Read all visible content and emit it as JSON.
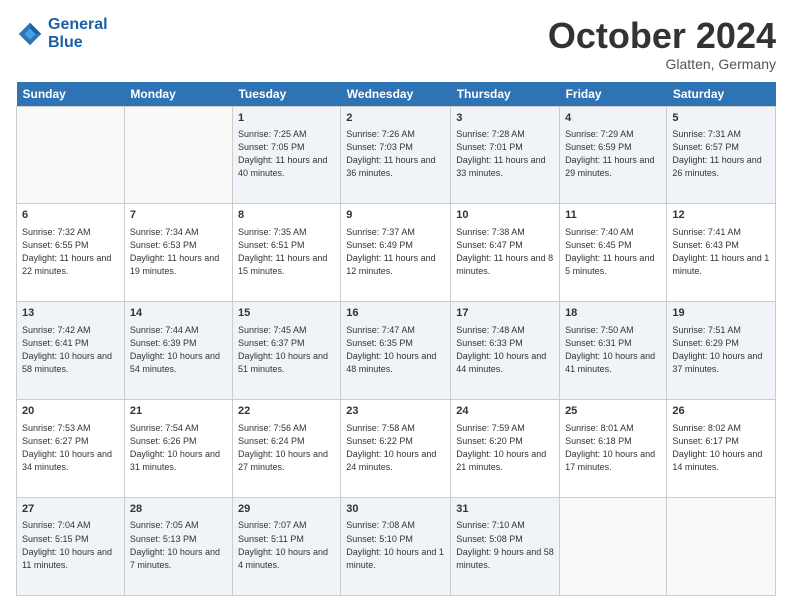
{
  "header": {
    "logo_line1": "General",
    "logo_line2": "Blue",
    "month_title": "October 2024",
    "location": "Glatten, Germany"
  },
  "days_of_week": [
    "Sunday",
    "Monday",
    "Tuesday",
    "Wednesday",
    "Thursday",
    "Friday",
    "Saturday"
  ],
  "weeks": [
    [
      {
        "day": "",
        "sunrise": "",
        "sunset": "",
        "daylight": ""
      },
      {
        "day": "",
        "sunrise": "",
        "sunset": "",
        "daylight": ""
      },
      {
        "day": "1",
        "sunrise": "Sunrise: 7:25 AM",
        "sunset": "Sunset: 7:05 PM",
        "daylight": "Daylight: 11 hours and 40 minutes."
      },
      {
        "day": "2",
        "sunrise": "Sunrise: 7:26 AM",
        "sunset": "Sunset: 7:03 PM",
        "daylight": "Daylight: 11 hours and 36 minutes."
      },
      {
        "day": "3",
        "sunrise": "Sunrise: 7:28 AM",
        "sunset": "Sunset: 7:01 PM",
        "daylight": "Daylight: 11 hours and 33 minutes."
      },
      {
        "day": "4",
        "sunrise": "Sunrise: 7:29 AM",
        "sunset": "Sunset: 6:59 PM",
        "daylight": "Daylight: 11 hours and 29 minutes."
      },
      {
        "day": "5",
        "sunrise": "Sunrise: 7:31 AM",
        "sunset": "Sunset: 6:57 PM",
        "daylight": "Daylight: 11 hours and 26 minutes."
      }
    ],
    [
      {
        "day": "6",
        "sunrise": "Sunrise: 7:32 AM",
        "sunset": "Sunset: 6:55 PM",
        "daylight": "Daylight: 11 hours and 22 minutes."
      },
      {
        "day": "7",
        "sunrise": "Sunrise: 7:34 AM",
        "sunset": "Sunset: 6:53 PM",
        "daylight": "Daylight: 11 hours and 19 minutes."
      },
      {
        "day": "8",
        "sunrise": "Sunrise: 7:35 AM",
        "sunset": "Sunset: 6:51 PM",
        "daylight": "Daylight: 11 hours and 15 minutes."
      },
      {
        "day": "9",
        "sunrise": "Sunrise: 7:37 AM",
        "sunset": "Sunset: 6:49 PM",
        "daylight": "Daylight: 11 hours and 12 minutes."
      },
      {
        "day": "10",
        "sunrise": "Sunrise: 7:38 AM",
        "sunset": "Sunset: 6:47 PM",
        "daylight": "Daylight: 11 hours and 8 minutes."
      },
      {
        "day": "11",
        "sunrise": "Sunrise: 7:40 AM",
        "sunset": "Sunset: 6:45 PM",
        "daylight": "Daylight: 11 hours and 5 minutes."
      },
      {
        "day": "12",
        "sunrise": "Sunrise: 7:41 AM",
        "sunset": "Sunset: 6:43 PM",
        "daylight": "Daylight: 11 hours and 1 minute."
      }
    ],
    [
      {
        "day": "13",
        "sunrise": "Sunrise: 7:42 AM",
        "sunset": "Sunset: 6:41 PM",
        "daylight": "Daylight: 10 hours and 58 minutes."
      },
      {
        "day": "14",
        "sunrise": "Sunrise: 7:44 AM",
        "sunset": "Sunset: 6:39 PM",
        "daylight": "Daylight: 10 hours and 54 minutes."
      },
      {
        "day": "15",
        "sunrise": "Sunrise: 7:45 AM",
        "sunset": "Sunset: 6:37 PM",
        "daylight": "Daylight: 10 hours and 51 minutes."
      },
      {
        "day": "16",
        "sunrise": "Sunrise: 7:47 AM",
        "sunset": "Sunset: 6:35 PM",
        "daylight": "Daylight: 10 hours and 48 minutes."
      },
      {
        "day": "17",
        "sunrise": "Sunrise: 7:48 AM",
        "sunset": "Sunset: 6:33 PM",
        "daylight": "Daylight: 10 hours and 44 minutes."
      },
      {
        "day": "18",
        "sunrise": "Sunrise: 7:50 AM",
        "sunset": "Sunset: 6:31 PM",
        "daylight": "Daylight: 10 hours and 41 minutes."
      },
      {
        "day": "19",
        "sunrise": "Sunrise: 7:51 AM",
        "sunset": "Sunset: 6:29 PM",
        "daylight": "Daylight: 10 hours and 37 minutes."
      }
    ],
    [
      {
        "day": "20",
        "sunrise": "Sunrise: 7:53 AM",
        "sunset": "Sunset: 6:27 PM",
        "daylight": "Daylight: 10 hours and 34 minutes."
      },
      {
        "day": "21",
        "sunrise": "Sunrise: 7:54 AM",
        "sunset": "Sunset: 6:26 PM",
        "daylight": "Daylight: 10 hours and 31 minutes."
      },
      {
        "day": "22",
        "sunrise": "Sunrise: 7:56 AM",
        "sunset": "Sunset: 6:24 PM",
        "daylight": "Daylight: 10 hours and 27 minutes."
      },
      {
        "day": "23",
        "sunrise": "Sunrise: 7:58 AM",
        "sunset": "Sunset: 6:22 PM",
        "daylight": "Daylight: 10 hours and 24 minutes."
      },
      {
        "day": "24",
        "sunrise": "Sunrise: 7:59 AM",
        "sunset": "Sunset: 6:20 PM",
        "daylight": "Daylight: 10 hours and 21 minutes."
      },
      {
        "day": "25",
        "sunrise": "Sunrise: 8:01 AM",
        "sunset": "Sunset: 6:18 PM",
        "daylight": "Daylight: 10 hours and 17 minutes."
      },
      {
        "day": "26",
        "sunrise": "Sunrise: 8:02 AM",
        "sunset": "Sunset: 6:17 PM",
        "daylight": "Daylight: 10 hours and 14 minutes."
      }
    ],
    [
      {
        "day": "27",
        "sunrise": "Sunrise: 7:04 AM",
        "sunset": "Sunset: 5:15 PM",
        "daylight": "Daylight: 10 hours and 11 minutes."
      },
      {
        "day": "28",
        "sunrise": "Sunrise: 7:05 AM",
        "sunset": "Sunset: 5:13 PM",
        "daylight": "Daylight: 10 hours and 7 minutes."
      },
      {
        "day": "29",
        "sunrise": "Sunrise: 7:07 AM",
        "sunset": "Sunset: 5:11 PM",
        "daylight": "Daylight: 10 hours and 4 minutes."
      },
      {
        "day": "30",
        "sunrise": "Sunrise: 7:08 AM",
        "sunset": "Sunset: 5:10 PM",
        "daylight": "Daylight: 10 hours and 1 minute."
      },
      {
        "day": "31",
        "sunrise": "Sunrise: 7:10 AM",
        "sunset": "Sunset: 5:08 PM",
        "daylight": "Daylight: 9 hours and 58 minutes."
      },
      {
        "day": "",
        "sunrise": "",
        "sunset": "",
        "daylight": ""
      },
      {
        "day": "",
        "sunrise": "",
        "sunset": "",
        "daylight": ""
      }
    ]
  ]
}
